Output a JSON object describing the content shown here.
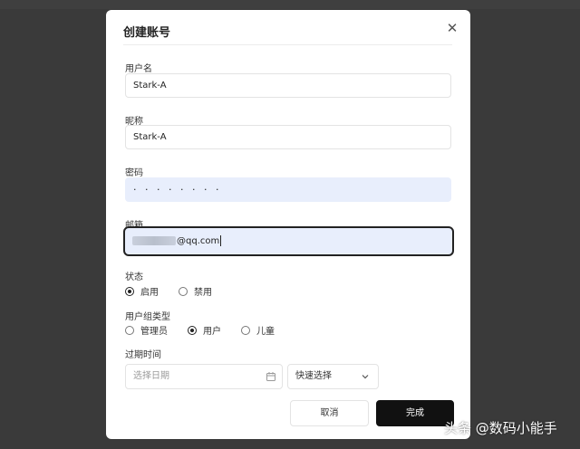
{
  "modal": {
    "title": "创建账号",
    "close_icon": "close-icon"
  },
  "form": {
    "username": {
      "label": "用户名",
      "value": "Stark-A"
    },
    "nickname": {
      "label": "昵称",
      "value": "Stark-A"
    },
    "password": {
      "label": "密码",
      "value": "· · · · · · · ·"
    },
    "email": {
      "label": "邮箱",
      "value": "@qq.com",
      "blurred_prefix": true
    },
    "status": {
      "label": "状态",
      "options": [
        {
          "label": "启用",
          "checked": true
        },
        {
          "label": "禁用",
          "checked": false
        }
      ]
    },
    "group_type": {
      "label": "用户组类型",
      "options": [
        {
          "label": "管理员",
          "checked": false
        },
        {
          "label": "用户",
          "checked": true
        },
        {
          "label": "儿童",
          "checked": false
        }
      ]
    },
    "expire_time": {
      "label": "过期时间",
      "date_placeholder": "选择日期",
      "quick_select": "快速选择"
    }
  },
  "buttons": {
    "cancel": "取消",
    "done": "完成"
  },
  "watermark": "头条 @数码小能手"
}
